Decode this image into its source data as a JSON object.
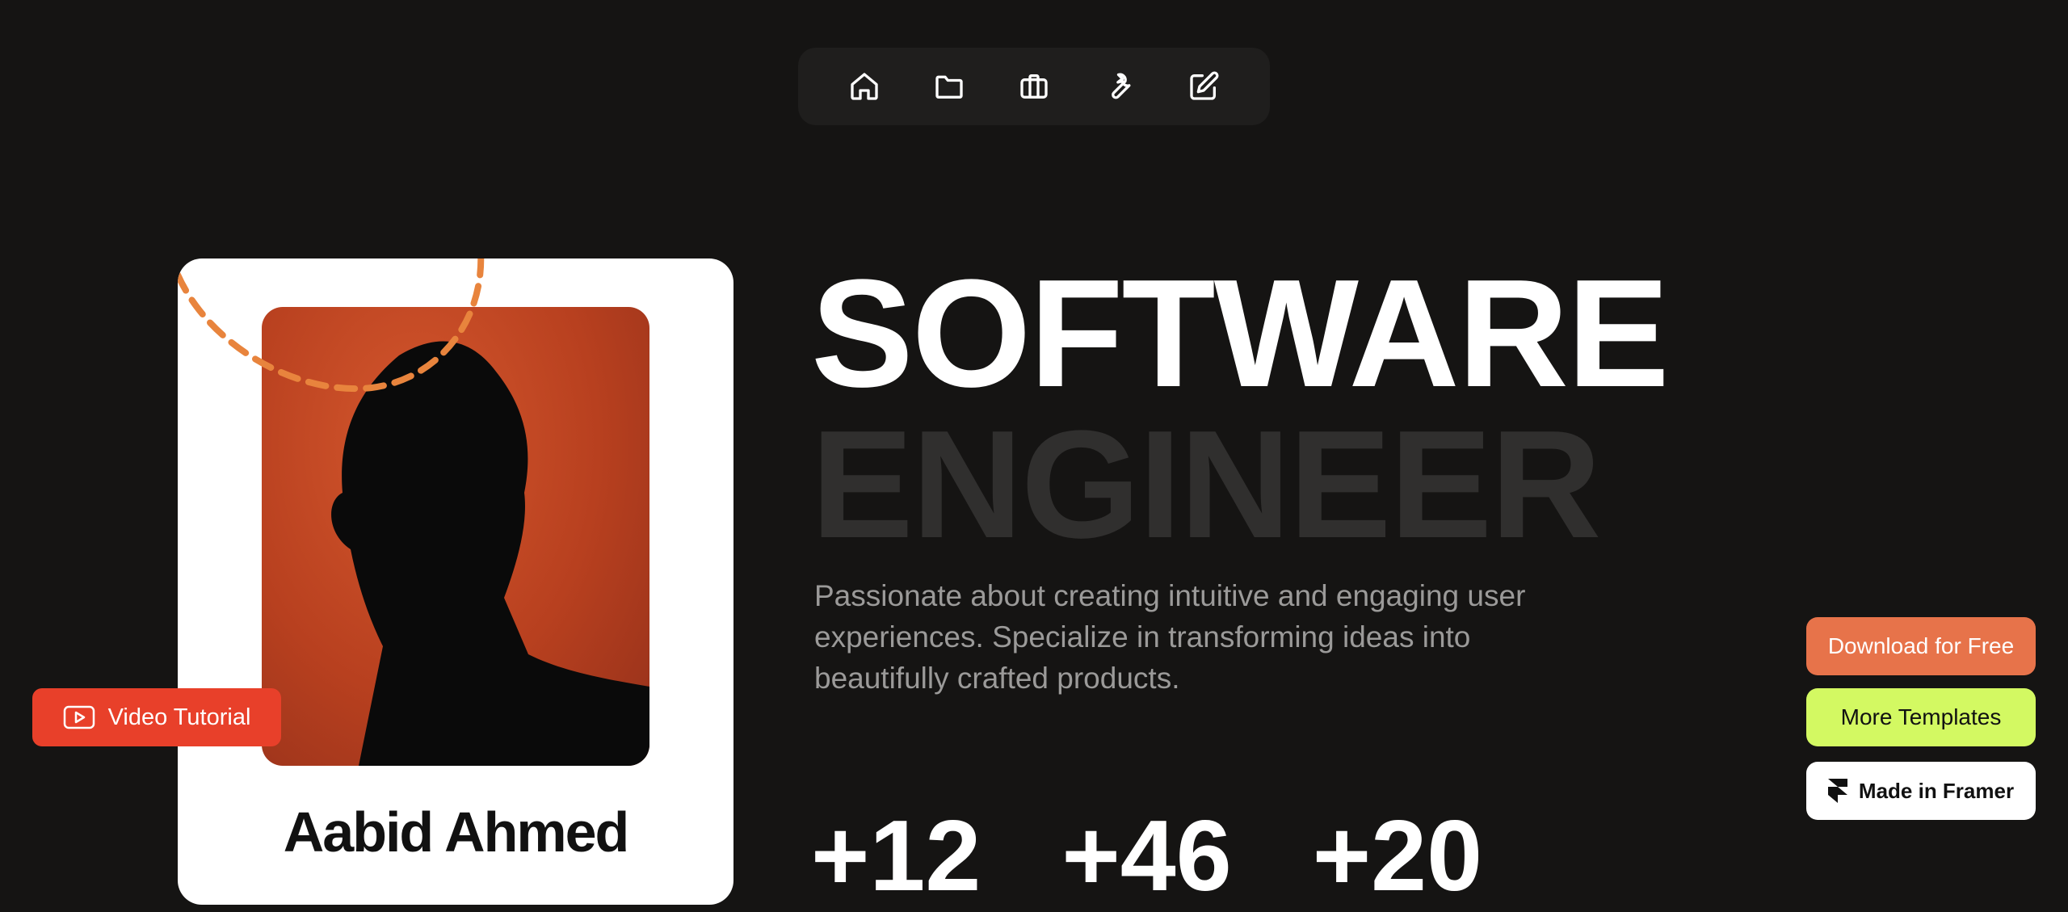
{
  "nav": {
    "items": [
      {
        "icon": "home-icon"
      },
      {
        "icon": "folder-icon"
      },
      {
        "icon": "briefcase-icon"
      },
      {
        "icon": "wrench-icon"
      },
      {
        "icon": "edit-icon"
      }
    ]
  },
  "profile": {
    "name": "Aabid Ahmed",
    "portrait_bg": "#c2461f",
    "accent_dash": "#e8843d"
  },
  "hero": {
    "title_line1": "SOFTWARE",
    "title_line2": "ENGINEER",
    "bio": "Passionate about creating intuitive and engaging user experiences. Specialize in transforming ideas into beautifully crafted products."
  },
  "stats": [
    "+12",
    "+46",
    "+20"
  ],
  "buttons": {
    "video_tutorial": "Video Tutorial",
    "download": "Download for Free",
    "templates": "More Templates",
    "framer": "Made in Framer"
  },
  "colors": {
    "background": "#151413",
    "download": "#e7734a",
    "templates": "#d3f962",
    "video": "#e8402a"
  }
}
